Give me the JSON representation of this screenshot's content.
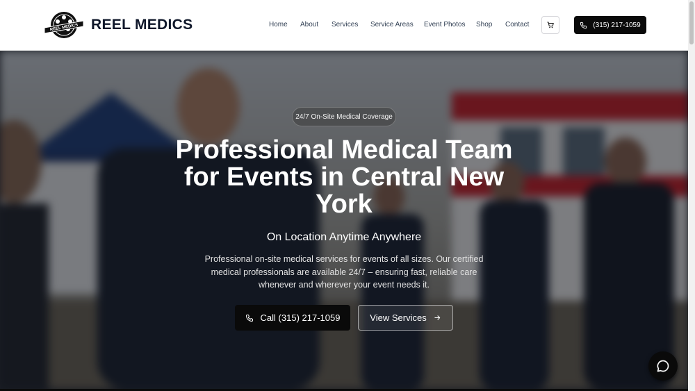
{
  "brand": {
    "name": "REEL MEDICS",
    "logo_text": "REEL MEDICS"
  },
  "nav": {
    "items": [
      "Home",
      "About",
      "Services",
      "Service Areas",
      "Event Photos",
      "Shop",
      "Contact"
    ]
  },
  "header": {
    "phone_label": "(315) 217-1059",
    "cart_icon": "cart-icon",
    "phone_icon": "phone-icon"
  },
  "hero": {
    "badge": "24/7 On-Site Medical Coverage",
    "title": "Professional Medical Team for Events in Central New York",
    "subtitle": "On Location Anytime Anywhere",
    "description": "Professional on-site medical services for events of all sizes. Our certified medical professionals are available 24/7 – ensuring fast, reliable care whenever and wherever your event needs it.",
    "call_button": "Call (315) 217-1059",
    "services_button": "View Services"
  },
  "chat": {
    "icon": "chat-bubble-icon"
  },
  "colors": {
    "primary": "#0a0a0a",
    "accent_red": "#c8202a",
    "text_dark": "#0f172a"
  }
}
